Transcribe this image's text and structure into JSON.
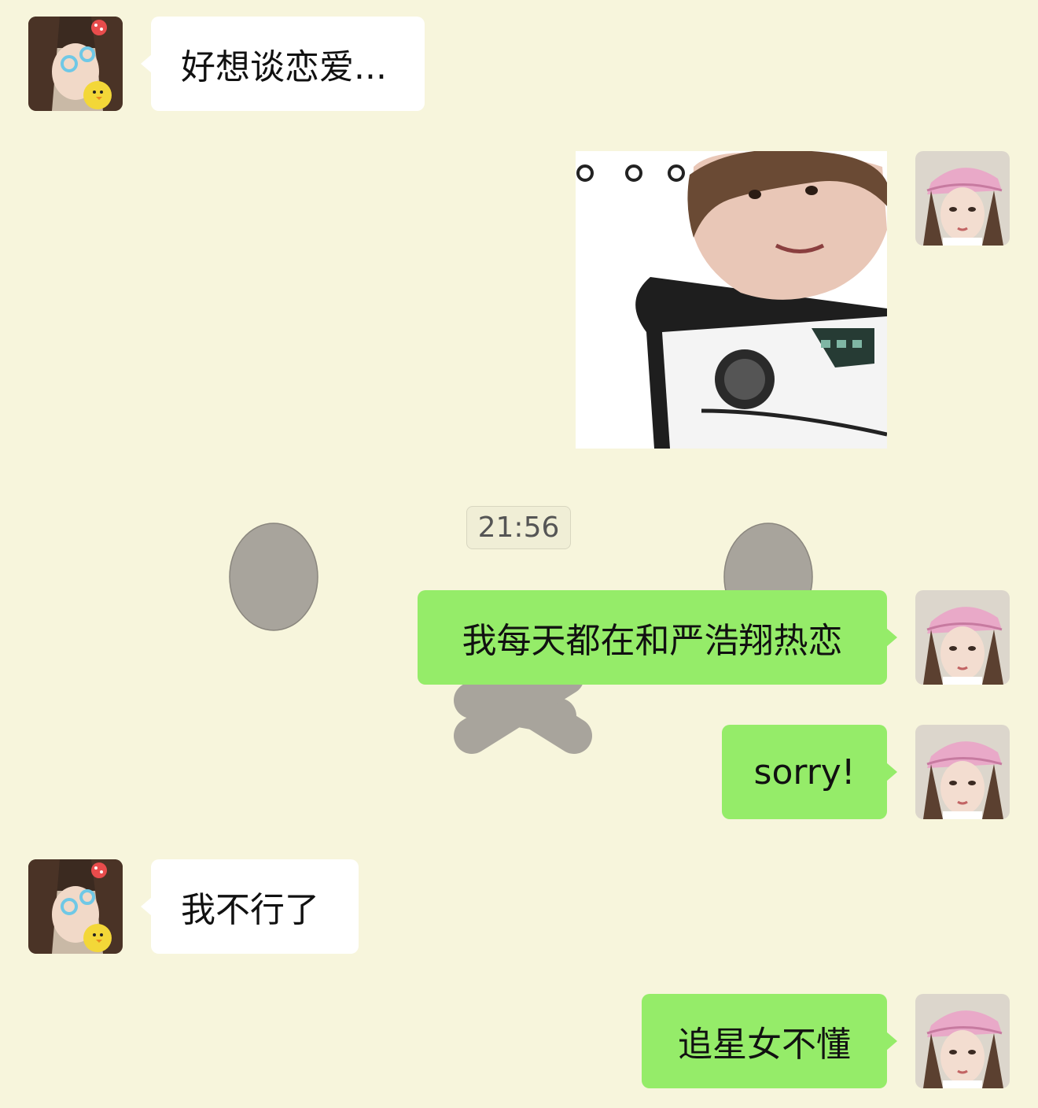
{
  "colors": {
    "background": "#f7f5dc",
    "incoming_bubble": "#ffffff",
    "outgoing_bubble": "#95ec69",
    "text": "#111111"
  },
  "timestamp": "21:56",
  "messages": [
    {
      "side": "left",
      "type": "text",
      "text": "好想谈恋爱..."
    },
    {
      "side": "right",
      "type": "sticker",
      "icon": "sticker-meme-icon"
    },
    {
      "side": "right",
      "type": "text",
      "text": "我每天都在和严浩翔热恋"
    },
    {
      "side": "right",
      "type": "text",
      "text": "sorry!"
    },
    {
      "side": "left",
      "type": "text",
      "text": "我不行了"
    },
    {
      "side": "right",
      "type": "text",
      "text": "追星女不懂"
    }
  ],
  "avatars": {
    "left": "girl-avatar-icon",
    "right": "pink-hat-girl-avatar-icon"
  }
}
